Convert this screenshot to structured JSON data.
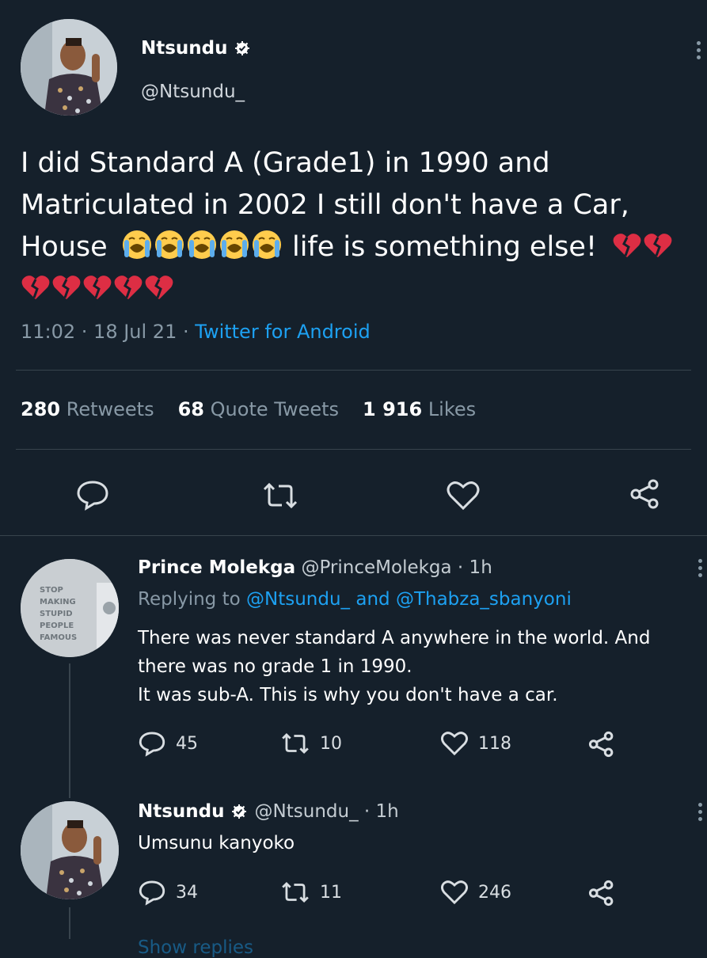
{
  "main_tweet": {
    "author_name": "Ntsundu",
    "handle": "@Ntsundu_",
    "text_line1": "I did Standard A (Grade1) in 1990 and",
    "text_line2": "Matriculated in 2002 I still don't have a Car,",
    "text_line3_prefix": "House",
    "text_line3_suffix": "life is something else!",
    "time": "11:02 · 18 Jul 21 ·",
    "source": "Twitter for Android",
    "retweets_count": "280",
    "retweets_label": "Retweets",
    "quotes_count": "68",
    "quotes_label": "Quote Tweets",
    "likes_count": "1 916",
    "likes_label": "Likes"
  },
  "reply1": {
    "author_name": "Prince Molekga",
    "handle_time": "@PrinceMolekga · 1h",
    "replying_prefix": "Replying to",
    "replying_user1": "@Ntsundu_",
    "replying_and": "and",
    "replying_user2": "@Thabza_sbanyoni",
    "text_line1": "There was never standard A anywhere in the world. And",
    "text_line2": "there was no grade 1 in 1990.",
    "text_line3": "It was sub-A. This is why you don't have a car.",
    "reply_count": "45",
    "retweet_count": "10",
    "like_count": "118",
    "avatar_sign_lines": [
      "STOP",
      "MAKING",
      "STUPID",
      "PEOPLE",
      "FAMOUS"
    ]
  },
  "reply2": {
    "author_name": "Ntsundu",
    "handle_time": "@Ntsundu_ · 1h",
    "text": "Umsunu kanyoko",
    "reply_count": "34",
    "retweet_count": "11",
    "like_count": "246"
  },
  "footer": {
    "show_replies": "Show replies"
  },
  "icons": {
    "verified": "verified-badge-icon",
    "more": "more-options-icon",
    "reply": "reply-icon",
    "retweet": "retweet-icon",
    "like": "heart-icon",
    "share": "share-icon",
    "crying": "crying-face-emoji",
    "broken_heart": "broken-heart-emoji"
  },
  "colors": {
    "background": "#15202b",
    "accent": "#1da1f2",
    "muted": "#8899a6",
    "divider": "#38444d",
    "broken_heart": "#e0245e"
  }
}
